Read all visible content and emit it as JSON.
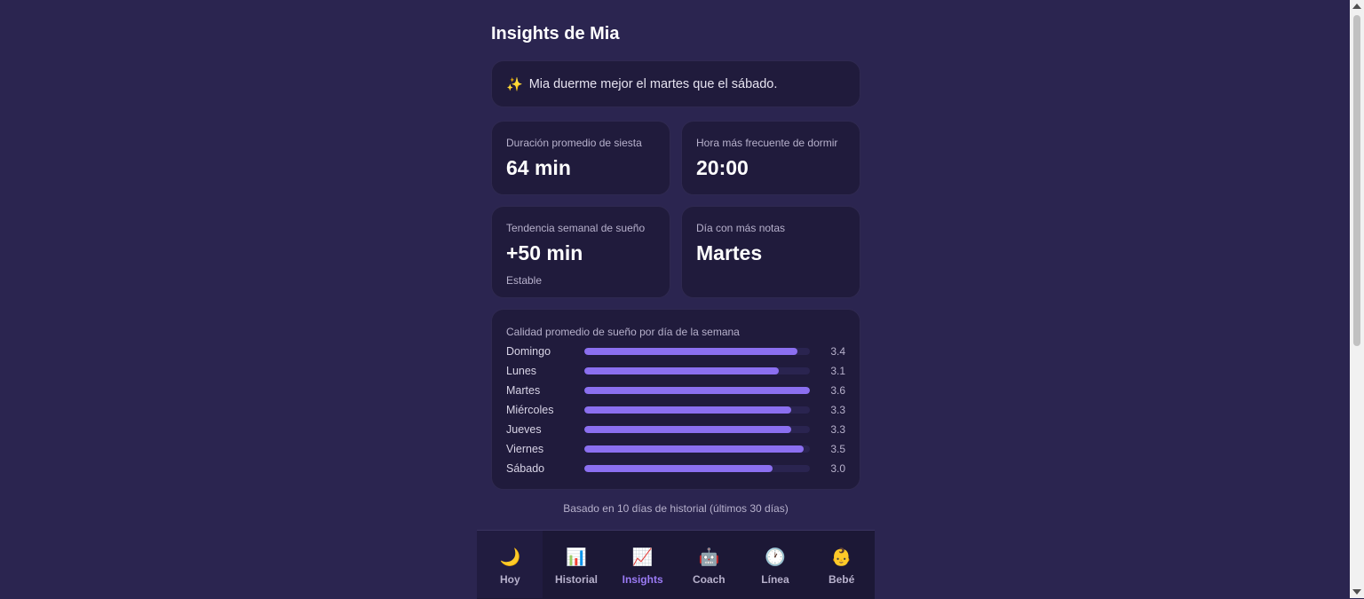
{
  "page": {
    "title": "Insights de Mia"
  },
  "banner": {
    "icon": "sparkles-icon",
    "glyph": "✨",
    "text": "Mia duerme mejor el martes que el sábado."
  },
  "stats": [
    {
      "label": "Duración promedio de siesta",
      "value": "64 min",
      "sub": ""
    },
    {
      "label": "Hora más frecuente de dormir",
      "value": "20:00",
      "sub": ""
    },
    {
      "label": "Tendencia semanal de sueño",
      "value": "+50 min",
      "sub": "Estable"
    },
    {
      "label": "Día con más notas",
      "value": "Martes",
      "sub": ""
    }
  ],
  "chart_data": {
    "type": "bar",
    "title": "Calidad promedio de sueño por día de la semana",
    "categories": [
      "Domingo",
      "Lunes",
      "Martes",
      "Miércoles",
      "Jueves",
      "Viernes",
      "Sábado"
    ],
    "values": [
      3.4,
      3.1,
      3.6,
      3.3,
      3.3,
      3.5,
      3.0
    ],
    "value_labels": [
      "3.4",
      "3.1",
      "3.6",
      "3.3",
      "3.3",
      "3.5",
      "3.0"
    ],
    "orientation": "horizontal",
    "xlim": [
      0,
      3.6
    ],
    "bar_color": "#8b6ff0"
  },
  "footnote": "Basado en 10 días de historial (últimos 30 días)",
  "nav": {
    "items": [
      {
        "label": "Hoy",
        "icon": "moon-icon",
        "glyph": "🌙"
      },
      {
        "label": "Historial",
        "icon": "bar-chart-icon",
        "glyph": "📊"
      },
      {
        "label": "Insights",
        "icon": "trend-chart-icon",
        "glyph": "📈"
      },
      {
        "label": "Coach",
        "icon": "robot-icon",
        "glyph": "🤖"
      },
      {
        "label": "Línea",
        "icon": "clock-icon",
        "glyph": "🕐"
      },
      {
        "label": "Bebé",
        "icon": "baby-icon",
        "glyph": "👶"
      }
    ],
    "selected": "Insights",
    "accent": "#9b7bf5"
  },
  "colors": {
    "background": "#2b2550",
    "card": "#201b3c",
    "accent": "#8b6ff0"
  }
}
